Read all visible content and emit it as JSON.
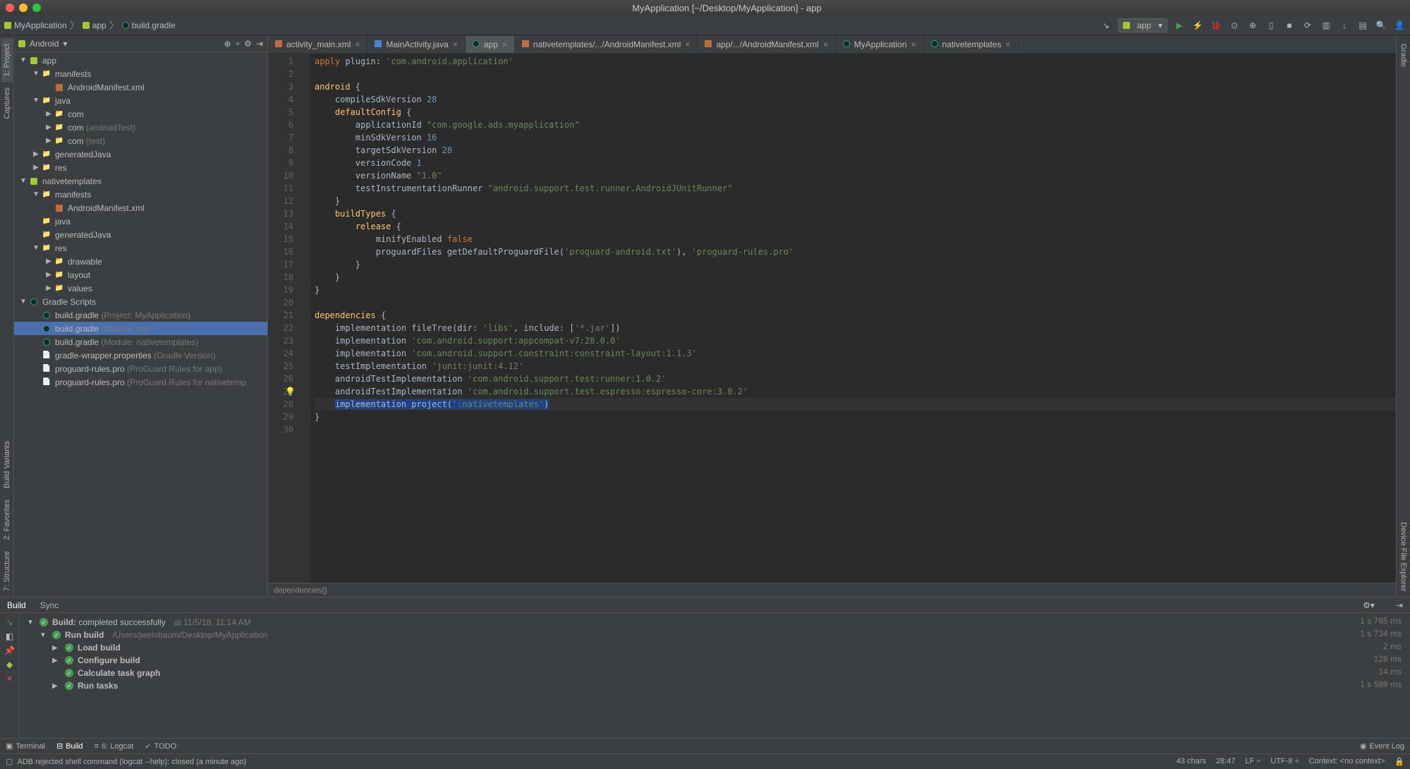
{
  "window": {
    "title": "MyApplication [~/Desktop/MyApplication] - app"
  },
  "breadcrumbs": {
    "items": [
      "MyApplication",
      "app",
      "build.gradle"
    ]
  },
  "run_config": "app",
  "left_tabs": [
    "1: Project",
    "Captures",
    "Build Variants",
    "2: Favorites",
    "7: Structure"
  ],
  "right_tabs": [
    "Gradle",
    "Device File Explorer"
  ],
  "project_panel": {
    "title": "Android",
    "tree": [
      {
        "depth": 0,
        "arrow": "▼",
        "icon": "module",
        "label": "app"
      },
      {
        "depth": 1,
        "arrow": "▼",
        "icon": "folder",
        "label": "manifests"
      },
      {
        "depth": 2,
        "arrow": "",
        "icon": "xml",
        "label": "AndroidManifest.xml"
      },
      {
        "depth": 1,
        "arrow": "▼",
        "icon": "folder",
        "label": "java"
      },
      {
        "depth": 2,
        "arrow": "▶",
        "icon": "folder",
        "label": "com"
      },
      {
        "depth": 2,
        "arrow": "▶",
        "icon": "folder",
        "label": "com",
        "muted": " (androidTest)"
      },
      {
        "depth": 2,
        "arrow": "▶",
        "icon": "folder",
        "label": "com",
        "muted": " (test)"
      },
      {
        "depth": 1,
        "arrow": "▶",
        "icon": "folder",
        "label": "generatedJava"
      },
      {
        "depth": 1,
        "arrow": "▶",
        "icon": "folder",
        "label": "res"
      },
      {
        "depth": 0,
        "arrow": "▼",
        "icon": "module",
        "label": "nativetemplates"
      },
      {
        "depth": 1,
        "arrow": "▼",
        "icon": "folder",
        "label": "manifests"
      },
      {
        "depth": 2,
        "arrow": "",
        "icon": "xml",
        "label": "AndroidManifest.xml"
      },
      {
        "depth": 1,
        "arrow": "",
        "icon": "folder",
        "label": "java"
      },
      {
        "depth": 1,
        "arrow": "",
        "icon": "folder",
        "label": "generatedJava"
      },
      {
        "depth": 1,
        "arrow": "▼",
        "icon": "folder",
        "label": "res"
      },
      {
        "depth": 2,
        "arrow": "▶",
        "icon": "folder",
        "label": "drawable"
      },
      {
        "depth": 2,
        "arrow": "▶",
        "icon": "folder",
        "label": "layout"
      },
      {
        "depth": 2,
        "arrow": "▶",
        "icon": "folder",
        "label": "values"
      },
      {
        "depth": 0,
        "arrow": "▼",
        "icon": "gradle",
        "label": "Gradle Scripts"
      },
      {
        "depth": 1,
        "arrow": "",
        "icon": "gradle",
        "label": "build.gradle",
        "muted": " (Project: MyApplication)"
      },
      {
        "depth": 1,
        "arrow": "",
        "icon": "gradle",
        "label": "build.gradle",
        "muted": " (Module: app)",
        "selected": true
      },
      {
        "depth": 1,
        "arrow": "",
        "icon": "gradle",
        "label": "build.gradle",
        "muted": " (Module: nativetemplates)"
      },
      {
        "depth": 1,
        "arrow": "",
        "icon": "file",
        "label": "gradle-wrapper.properties",
        "muted": " (Gradle Version)"
      },
      {
        "depth": 1,
        "arrow": "",
        "icon": "file",
        "label": "proguard-rules.pro",
        "muted": " (ProGuard Rules for app)"
      },
      {
        "depth": 1,
        "arrow": "",
        "icon": "file",
        "label": "proguard-rules.pro",
        "muted": " (ProGuard Rules for nativetemp"
      }
    ]
  },
  "tabs": [
    {
      "label": "activity_main.xml",
      "icon": "xml",
      "close": true
    },
    {
      "label": "MainActivity.java",
      "icon": "java",
      "close": true
    },
    {
      "label": "app",
      "icon": "gradle",
      "active": true,
      "close": true
    },
    {
      "label": "nativetemplates/.../AndroidManifest.xml",
      "icon": "xml",
      "close": true
    },
    {
      "label": "app/.../AndroidManifest.xml",
      "icon": "xml",
      "close": true
    },
    {
      "label": "MyApplication",
      "icon": "gradle",
      "close": true
    },
    {
      "label": "nativetemplates",
      "icon": "gradle",
      "close": true
    }
  ],
  "editor": {
    "breadcrumb": "dependencies{}",
    "lines": [
      {
        "n": 1,
        "html": "<span class='kw'>apply</span> plugin: <span class='str'>'com.android.application'</span>"
      },
      {
        "n": 2,
        "html": ""
      },
      {
        "n": 3,
        "html": "<span class='fn'>android</span> {"
      },
      {
        "n": 4,
        "html": "    compileSdkVersion <span class='num'>28</span>"
      },
      {
        "n": 5,
        "html": "    <span class='fn'>defaultConfig</span> {"
      },
      {
        "n": 6,
        "html": "        applicationId <span class='str'>\"com.google.ads.myapplication\"</span>"
      },
      {
        "n": 7,
        "html": "        minSdkVersion <span class='num'>16</span>"
      },
      {
        "n": 8,
        "html": "        targetSdkVersion <span class='num'>28</span>"
      },
      {
        "n": 9,
        "html": "        versionCode <span class='num'>1</span>"
      },
      {
        "n": 10,
        "html": "        versionName <span class='str'>\"1.0\"</span>"
      },
      {
        "n": 11,
        "html": "        testInstrumentationRunner <span class='str'>\"android.support.test.runner.AndroidJUnitRunner\"</span>"
      },
      {
        "n": 12,
        "html": "    }"
      },
      {
        "n": 13,
        "html": "    <span class='fn'>buildTypes</span> {"
      },
      {
        "n": 14,
        "html": "        <span class='fn'>release</span> {"
      },
      {
        "n": 15,
        "html": "            minifyEnabled <span class='kw'>false</span>"
      },
      {
        "n": 16,
        "html": "            proguardFiles getDefaultProguardFile(<span class='str'>'proguard-android.txt'</span>), <span class='str'>'proguard-rules.pro'</span>"
      },
      {
        "n": 17,
        "html": "        }"
      },
      {
        "n": 18,
        "html": "    }"
      },
      {
        "n": 19,
        "html": "}"
      },
      {
        "n": 20,
        "html": ""
      },
      {
        "n": 21,
        "html": "<span class='fn'>dependencies</span> {"
      },
      {
        "n": 22,
        "html": "    implementation fileTree(dir: <span class='str'>'libs'</span>, include: [<span class='str'>'*.jar'</span>])"
      },
      {
        "n": 23,
        "html": "    implementation <span class='str'>'com.android.support:appcompat-v7:28.0.0'</span>"
      },
      {
        "n": 24,
        "html": "    implementation <span class='str'>'com.android.support.constraint:constraint-layout:1.1.3'</span>"
      },
      {
        "n": 25,
        "html": "    testImplementation <span class='str'>'junit:junit:4.12'</span>"
      },
      {
        "n": 26,
        "html": "    androidTestImplementation <span class='str'>'com.android.support.test:runner:1.0.2'</span>"
      },
      {
        "n": 27,
        "html": "    androidTestImplementation <span class='str'>'com.android.support.test.espresso:espresso-core:3.0.2'</span>",
        "bulb": true
      },
      {
        "n": 28,
        "html": "    <span class='sel'>implementation project(<span class='str'>':nativetemplates'</span>)</span>",
        "hl": true
      },
      {
        "n": 29,
        "html": "}"
      },
      {
        "n": 30,
        "html": ""
      }
    ]
  },
  "bottom": {
    "tabs": [
      "Build",
      "Sync"
    ],
    "active": "Build",
    "rows": [
      {
        "depth": 0,
        "arrow": "▼",
        "ok": true,
        "label": "Build:",
        "extra": " completed successfully",
        "meta": "  at 11/5/18, 11:14 AM",
        "time": "1 s 785 ms"
      },
      {
        "depth": 1,
        "arrow": "▼",
        "ok": true,
        "label": "Run build",
        "meta": "  /Users/jweisbaum/Desktop/MyApplication",
        "time": "1 s 734 ms"
      },
      {
        "depth": 2,
        "arrow": "▶",
        "ok": true,
        "label": "Load build",
        "time": "2 ms"
      },
      {
        "depth": 2,
        "arrow": "▶",
        "ok": true,
        "label": "Configure build",
        "time": "128 ms"
      },
      {
        "depth": 2,
        "arrow": "",
        "ok": true,
        "label": "Calculate task graph",
        "time": "14 ms"
      },
      {
        "depth": 2,
        "arrow": "▶",
        "ok": true,
        "label": "Run tasks",
        "time": "1 s 589 ms"
      }
    ]
  },
  "bottom_toolbar": {
    "items": [
      "Terminal",
      "Build",
      "6: Logcat",
      "TODO"
    ],
    "active": "Build",
    "right": "Event Log"
  },
  "status": {
    "left": "ADB rejected shell command (logcat --help): closed (a minute ago)",
    "right": [
      "43 chars",
      "28:47",
      "LF ÷",
      "UTF-8 ÷",
      "Context: <no context>"
    ]
  }
}
